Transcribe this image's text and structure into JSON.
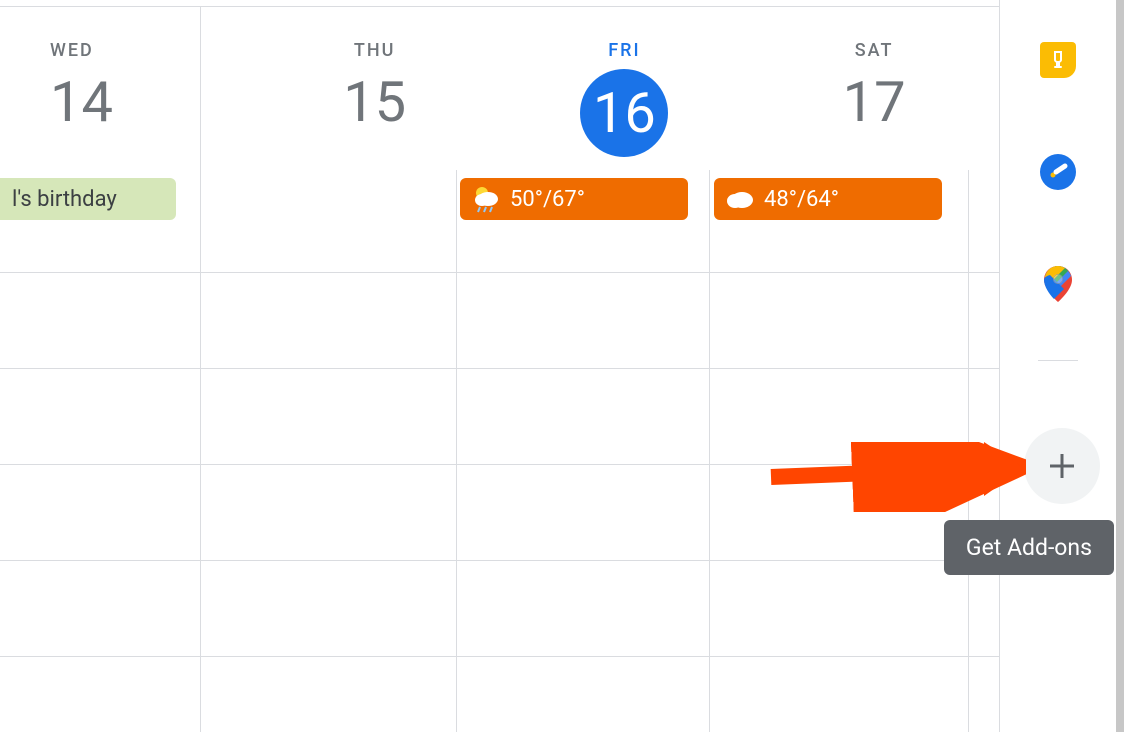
{
  "days": [
    {
      "name": "WED",
      "number": "14",
      "today": false
    },
    {
      "name": "THU",
      "number": "15",
      "today": false
    },
    {
      "name": "FRI",
      "number": "16",
      "today": true
    },
    {
      "name": "SAT",
      "number": "17",
      "today": false
    }
  ],
  "events": {
    "birthday": "l's birthday",
    "weather1": "50°/67°",
    "weather2": "48°/64°"
  },
  "tooltip": "Get Add-ons"
}
